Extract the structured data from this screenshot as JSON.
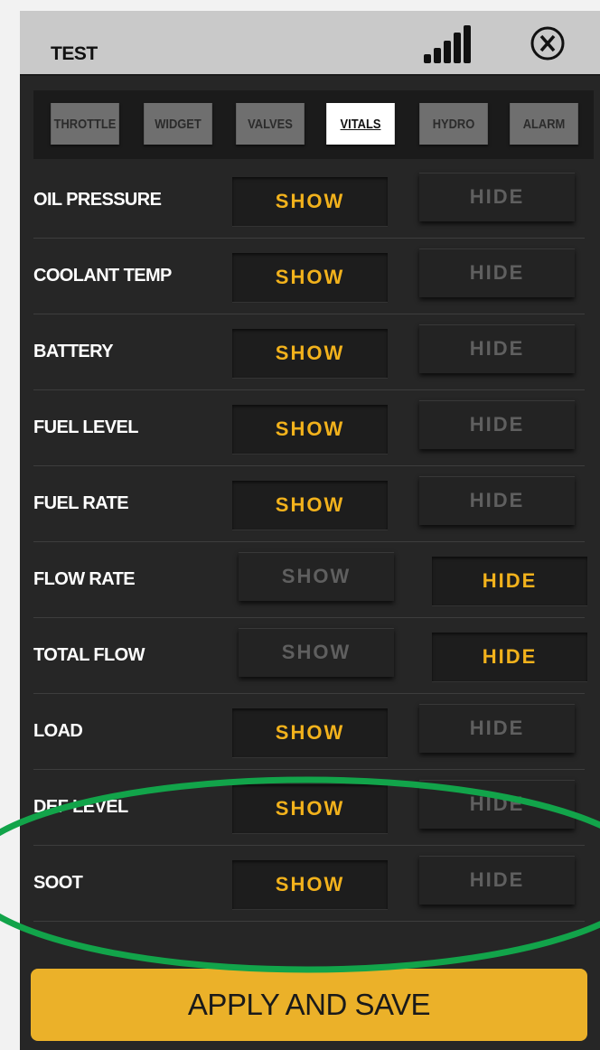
{
  "header": {
    "title": "TEST",
    "icons": [
      "signal-bars-icon",
      "close-circle-icon"
    ]
  },
  "tabs": [
    {
      "label": "THROTTLE",
      "active": false
    },
    {
      "label": "WIDGET",
      "active": false
    },
    {
      "label": "VALVES",
      "active": false
    },
    {
      "label": "VITALS",
      "active": true
    },
    {
      "label": "HYDRO",
      "active": false
    },
    {
      "label": "ALARM",
      "active": false
    }
  ],
  "rows": [
    {
      "label": "OIL PRESSURE",
      "show": "SHOW",
      "hide": "HIDE",
      "selected": "show"
    },
    {
      "label": "COOLANT TEMP",
      "show": "SHOW",
      "hide": "HIDE",
      "selected": "show"
    },
    {
      "label": "BATTERY",
      "show": "SHOW",
      "hide": "HIDE",
      "selected": "show"
    },
    {
      "label": "FUEL LEVEL",
      "show": "SHOW",
      "hide": "HIDE",
      "selected": "show"
    },
    {
      "label": "FUEL RATE",
      "show": "SHOW",
      "hide": "HIDE",
      "selected": "show"
    },
    {
      "label": "FLOW RATE",
      "show": "SHOW",
      "hide": "HIDE",
      "selected": "hide"
    },
    {
      "label": "TOTAL FLOW",
      "show": "SHOW",
      "hide": "HIDE",
      "selected": "hide"
    },
    {
      "label": "LOAD",
      "show": "SHOW",
      "hide": "HIDE",
      "selected": "show"
    },
    {
      "label": "DEF LEVEL",
      "show": "SHOW",
      "hide": "HIDE",
      "selected": "show"
    },
    {
      "label": "SOOT",
      "show": "SHOW",
      "hide": "HIDE",
      "selected": "show"
    }
  ],
  "apply_label": "APPLY AND SAVE",
  "colors": {
    "accent": "#f2b21c",
    "apply_button": "#ebb129",
    "highlight": "#12a44a",
    "panel": "#262626"
  }
}
